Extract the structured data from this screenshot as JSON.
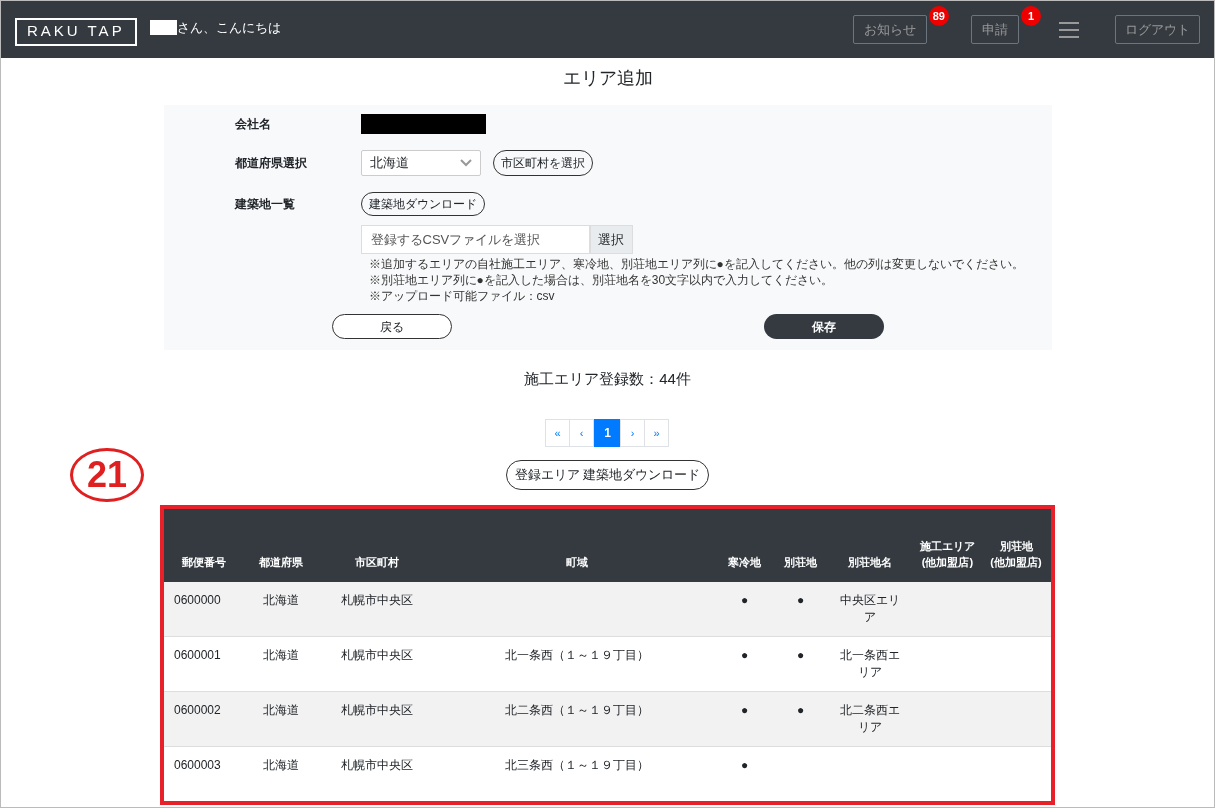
{
  "header": {
    "logo": "RAKU TAP",
    "greeting": "さん、こんにちは",
    "buttons": [
      {
        "label": "お知らせ",
        "badge": "89"
      },
      {
        "label": "申請",
        "badge": "1"
      }
    ],
    "logout": "ログアウト"
  },
  "title": "エリア追加",
  "form": {
    "company_label": "会社名",
    "prefecture_label": "都道府県選択",
    "prefecture_value": "北海道",
    "city_button": "市区町村を選択",
    "list_label": "建築地一覧",
    "download_button": "建築地ダウンロード",
    "file_placeholder": "登録するCSVファイルを選択",
    "file_button": "選択",
    "notes": [
      "※追加するエリアの自社施工エリア、寒冷地、別荘地エリア列に●を記入してください。他の列は変更しないでください。",
      "※別荘地エリア列に●を記入した場合は、別荘地名を30文字以内で入力してください。",
      "※アップロード可能ファイル：csv"
    ],
    "back_button": "戻る",
    "save_button": "保存"
  },
  "count": "施工エリア登録数：44件",
  "pagination": [
    {
      "label": "«",
      "selected": false
    },
    {
      "label": "‹",
      "selected": false
    },
    {
      "label": "1",
      "selected": true
    },
    {
      "label": "›",
      "selected": false
    },
    {
      "label": "»",
      "selected": false
    }
  ],
  "area_download_button": "登録エリア 建築地ダウンロード",
  "annotation": "21",
  "table": {
    "columns": [
      "郵便番号",
      "都道府県",
      "市区町村",
      "町域",
      "寒冷地",
      "別荘地",
      "別荘地名",
      "施工エリア\n(他加盟店)",
      "別荘地\n(他加盟店)"
    ],
    "rows": [
      [
        "0600000",
        "北海道",
        "札幌市中央区",
        "",
        "●",
        "●",
        "中央区エリア",
        "",
        ""
      ],
      [
        "0600001",
        "北海道",
        "札幌市中央区",
        "北一条西（１～１９丁目）",
        "●",
        "●",
        "北一条西エリア",
        "",
        ""
      ],
      [
        "0600002",
        "北海道",
        "札幌市中央区",
        "北二条西（１～１９丁目）",
        "●",
        "●",
        "北二条西エリア",
        "",
        ""
      ],
      [
        "0600003",
        "北海道",
        "札幌市中央区",
        "北三条西（１～１９丁目）",
        "●",
        "",
        "",
        "",
        ""
      ]
    ]
  }
}
